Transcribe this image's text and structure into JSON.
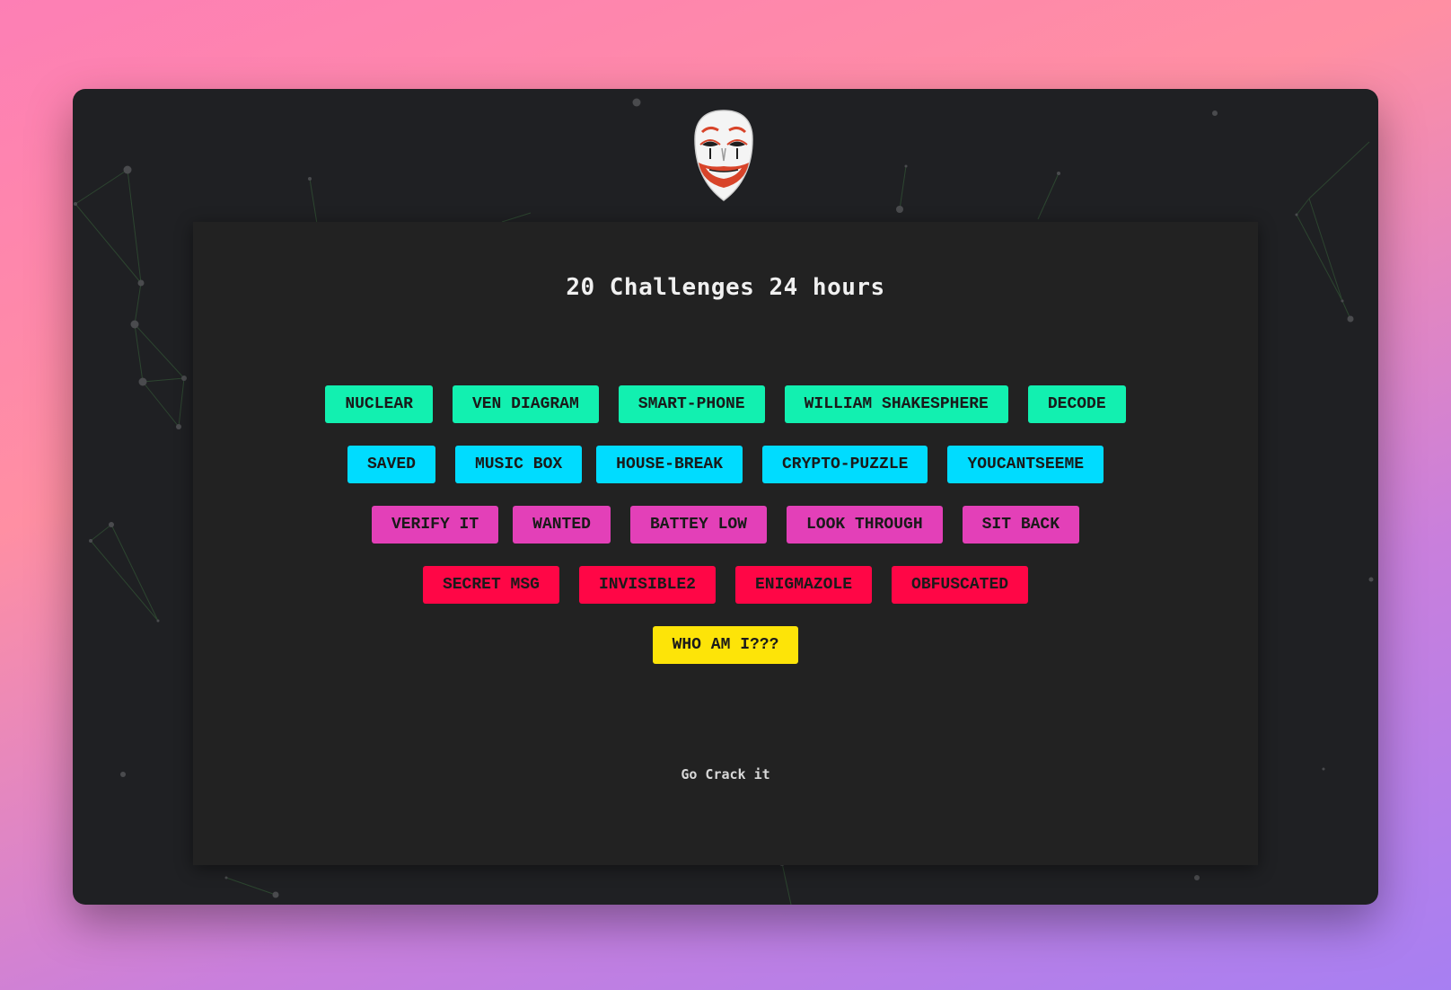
{
  "page": {
    "title": "20 Challenges 24 hours",
    "footer": "Go Crack it",
    "logo_icon": "mask-icon"
  },
  "colors": {
    "background_gradient": [
      "#fd7fb5",
      "#ff8fa3",
      "#c97fdc",
      "#a77ff2"
    ],
    "window": "#1f2023",
    "panel": "#222222",
    "green": "#12f0b0",
    "cyan": "#00dcff",
    "pink": "#e340b8",
    "red": "#ff0646",
    "yellow": "#fde408"
  },
  "challenges": {
    "row1": [
      "NUCLEAR",
      "VEN DIAGRAM",
      "SMART-PHONE",
      "WILLIAM SHAKESPHERE",
      "DECODE"
    ],
    "row2": [
      "SAVED",
      "MUSIC BOX",
      "HOUSE-BREAK",
      "CRYPTO-PUZZLE",
      "YOUCANTSEEME"
    ],
    "row3": [
      "VERIFY IT",
      "WANTED",
      "BATTEY LOW",
      "LOOK THROUGH",
      "SIT BACK"
    ],
    "row4": [
      "SECRET MSG",
      "INVISIBLE2",
      "ENIGMAZOLE",
      "OBFUSCATED"
    ],
    "row5": [
      "WHO AM I???"
    ]
  }
}
